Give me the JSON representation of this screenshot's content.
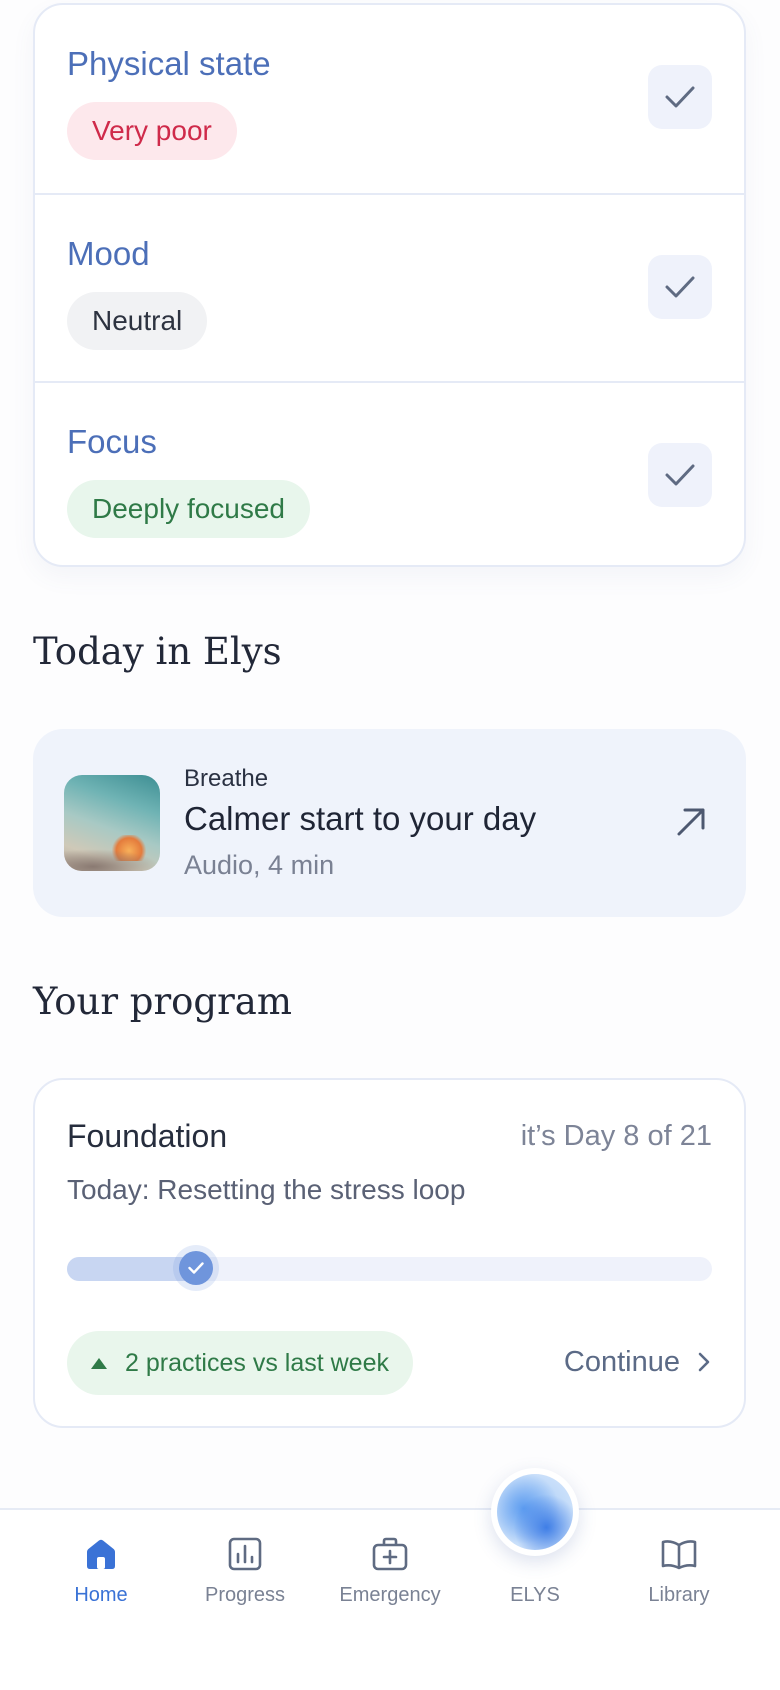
{
  "checkin": {
    "rows": [
      {
        "label": "Physical state",
        "value": "Very poor"
      },
      {
        "label": "Mood",
        "value": "Neutral"
      },
      {
        "label": "Focus",
        "value": "Deeply focused"
      }
    ]
  },
  "today": {
    "section_title": "Today in Elys",
    "eyebrow": "Breathe",
    "title": "Calmer start to your day",
    "subtitle": "Audio, 4 min"
  },
  "program": {
    "section_title": "Your program",
    "name": "Foundation",
    "day_text": "it’s Day 8 of 21",
    "today_text": "Today: Resetting the stress loop",
    "progress": 0.2,
    "trend_text": "2 practices vs last week",
    "continue_label": "Continue"
  },
  "tabs": [
    {
      "label": "Home",
      "icon": "home-icon",
      "active": true
    },
    {
      "label": "Progress",
      "icon": "bar-chart-icon",
      "active": false
    },
    {
      "label": "Emergency",
      "icon": "first-aid-icon",
      "active": false
    },
    {
      "label": "ELYS",
      "icon": "elys-orb-icon",
      "active": false
    },
    {
      "label": "Library",
      "icon": "book-icon",
      "active": false
    }
  ],
  "colors": {
    "accent": "#3a72d6",
    "label_blue": "#4c6fb8",
    "poor_red": "#cf2a4a",
    "focus_green": "#2f7a47"
  }
}
